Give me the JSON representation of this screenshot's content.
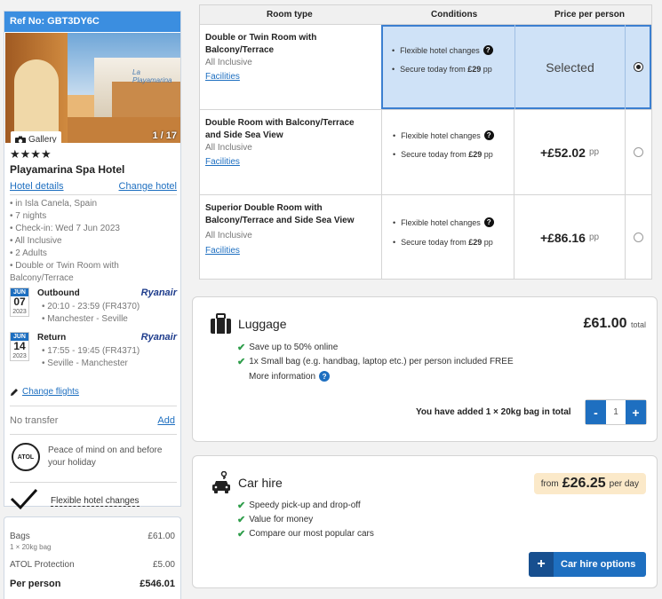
{
  "sidebar": {
    "ref": "Ref No: GBT3DY6C",
    "gallery_label": "Gallery",
    "image_count": "1 / 17",
    "image_sign": "La Playamarina",
    "stars": "★★★★",
    "hotel_name": "Playamarina Spa Hotel",
    "hotel_details_link": "Hotel details",
    "change_hotel_link": "Change hotel",
    "details": [
      "in Isla Canela, Spain",
      "7 nights",
      "Check-in: Wed 7 Jun 2023",
      "All Inclusive",
      "2 Adults",
      "Double or Twin Room with Balcony/Terrace"
    ],
    "outbound": {
      "month": "JUN",
      "day": "07",
      "year": "2023",
      "title": "Outbound",
      "airline": "Ryanair",
      "time": "20:10 - 23:59 (FR4370)",
      "route": "Manchester - Seville"
    },
    "return": {
      "month": "JUN",
      "day": "14",
      "year": "2023",
      "title": "Return",
      "airline": "Ryanair",
      "time": "17:55 - 19:45 (FR4371)",
      "route": "Seville - Manchester"
    },
    "change_flights_link": "Change flights",
    "no_transfer": "No transfer",
    "add_link": "Add",
    "atol_badge": "ATOL",
    "atol_text": "Peace of mind on and before your holiday",
    "flex_text": "Flexible hotel changes"
  },
  "summary": {
    "bags_label": "Bags",
    "bags_value": "£61.00",
    "bags_sub": "1 × 20kg bag",
    "atol_label": "ATOL Protection",
    "atol_value": "£5.00",
    "pp_label": "Per person",
    "pp_value": "£546.01"
  },
  "rooms": {
    "headers": {
      "type": "Room type",
      "conditions": "Conditions",
      "price": "Price per person"
    },
    "rows": [
      {
        "name": "Double or Twin Room with Balcony/Terrace",
        "board": "All Inclusive",
        "facilities": "Facilities",
        "cond1": "Flexible hotel changes",
        "cond2_prefix": "Secure today from ",
        "cond2_price": "£29",
        "cond2_suffix": " pp",
        "price": "Selected",
        "price_suffix": "",
        "selected": true
      },
      {
        "name": "Double Room with Balcony/Terrace and Side Sea View",
        "board": "All Inclusive",
        "facilities": "Facilities",
        "cond1": "Flexible hotel changes",
        "cond2_prefix": "Secure today from ",
        "cond2_price": "£29",
        "cond2_suffix": " pp",
        "price": "+£52.02",
        "price_suffix": "pp",
        "selected": false
      },
      {
        "name": "Superior Double Room with Balcony/Terrace and Side Sea View",
        "board": "All Inclusive",
        "facilities": "Facilities",
        "cond1": "Flexible hotel changes",
        "cond2_prefix": "Secure today from ",
        "cond2_price": "£29",
        "cond2_suffix": " pp",
        "price": "+£86.16",
        "price_suffix": "pp",
        "selected": false
      }
    ]
  },
  "luggage": {
    "title": "Luggage",
    "price": "£61.00",
    "price_suffix": "total",
    "bullets": [
      "Save up to 50% online",
      "1x Small bag (e.g. handbag, laptop etc.) per person included FREE"
    ],
    "more_info": "More information",
    "added_text": "You have added 1 × 20kg bag in total",
    "minus": "-",
    "quantity": "1",
    "plus": "+"
  },
  "car_hire": {
    "title": "Car hire",
    "price_prefix": "from",
    "price": "£26.25",
    "price_suffix": "per day",
    "bullets": [
      "Speedy pick-up and drop-off",
      "Value for money",
      "Compare our most popular cars"
    ],
    "button_icon": "+",
    "button_label": "Car hire options"
  },
  "colors": {
    "accent": "#1e6fc0",
    "ref_bar": "#3b8ee0",
    "selected_bg": "#cfe2f7",
    "tick": "#2e9d4a",
    "car_price_bg": "#fbe9c9"
  }
}
